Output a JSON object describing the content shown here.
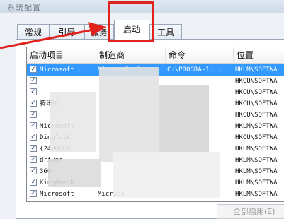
{
  "title": "系统配置",
  "tabs": [
    "常规",
    "引导",
    "服务",
    "启动",
    "工具"
  ],
  "active_tab": "启动",
  "columns": [
    "启动项目",
    "制造商",
    "命令",
    "位置"
  ],
  "rows": [
    {
      "item": "Microsoft...",
      "maker": "Microsoft C...",
      "command": "C:\\PROGRA~1...",
      "location": "HKLM\\SOFTWA",
      "checked": true,
      "selected": true
    },
    {
      "item": "",
      "maker": "",
      "command": "",
      "location": "HKCU\\SOFTWA",
      "checked": true
    },
    {
      "item": "",
      "maker": "",
      "command": "",
      "location": "HKCU\\SOFTWA",
      "checked": true
    },
    {
      "item": "腾讯QQ",
      "maker": "",
      "command": "",
      "location": "HKCU\\SOFTWA",
      "checked": true
    },
    {
      "item": "",
      "maker": "",
      "command": "",
      "location": "HKCU\\SOFTWA",
      "checked": true
    },
    {
      "item": "Microsoft",
      "maker": "",
      "command": "",
      "location": "HKLM\\SOFTWA",
      "checked": true
    },
    {
      "item": "DingTalk",
      "maker": "",
      "command": "",
      "location": "HKCU\\SOFTWA",
      "checked": true
    },
    {
      "item": "{249D8C6",
      "maker": "",
      "command": "",
      "location": "HKLM\\SOFTWA",
      "checked": true
    },
    {
      "item": "driver",
      "maker": "",
      "command": "",
      "location": "HKLM\\SOFTWA",
      "checked": true
    },
    {
      "item": "360",
      "maker": "",
      "command": "",
      "location": "HKLM\\SOFTWA",
      "checked": true
    },
    {
      "item": "Kingdee.D...",
      "maker": "",
      "command": "",
      "location": "HKLM\\SOFTWA",
      "checked": true
    },
    {
      "item": "Microsoft",
      "maker": "Microso",
      "command": "",
      "location": "HKLM\\SOFTWA",
      "checked": true
    }
  ],
  "bottom_button": "全部启用(E)",
  "accent_color": "#3399ff",
  "annotation_color": "#e0231d"
}
